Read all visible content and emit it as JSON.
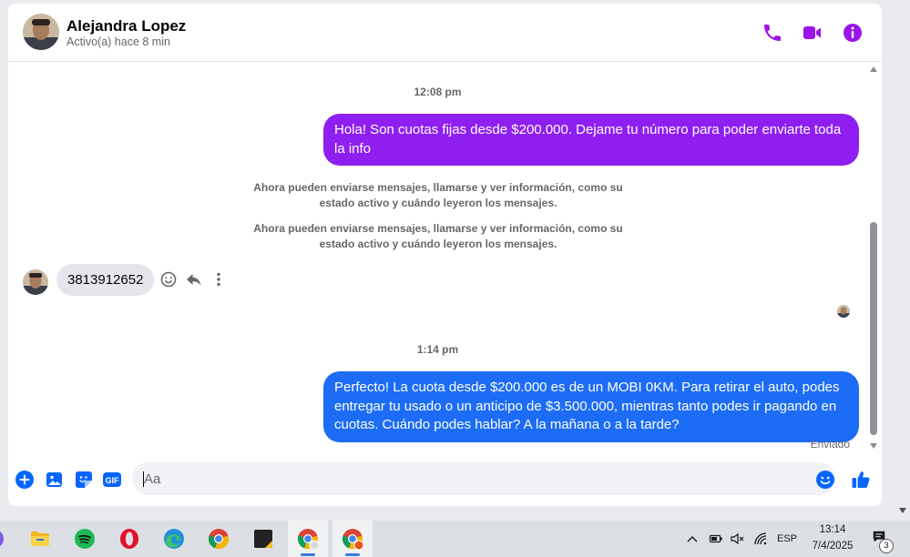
{
  "header": {
    "contact_name": "Alejandra Lopez",
    "status": "Activo(a) hace 8 min",
    "icons": [
      "phone-icon",
      "video-camera-icon",
      "info-icon"
    ]
  },
  "messages": {
    "timestamp_1": "12:08 pm",
    "outgoing_1": "Hola! Son cuotas fijas desde $200.000. Dejame tu número para poder enviarte toda la info",
    "system_note_1": "Ahora pueden enviarse mensajes, llamarse y ver información, como su estado activo y cuándo leyeron los mensajes.",
    "system_note_2": "Ahora pueden enviarse mensajes, llamarse y ver información, como su estado activo y cuándo leyeron los mensajes.",
    "incoming_1": "3813912652",
    "timestamp_2": "1:14 pm",
    "outgoing_2": "Perfecto! La cuota desde $200.000 es de un MOBI 0KM. Para retirar el auto, podes entregar tu usado o un anticipo de $3.500.000, mientras tanto podes ir pagando en cuotas. Cuándo podes hablar? A la mañana o a la tarde?",
    "sent_status": "Enviado"
  },
  "composer": {
    "placeholder": "Aa",
    "gif_label": "GIF"
  },
  "colors": {
    "accent_purple": "#9b13ee",
    "bubble_purple": "#8f1ff0",
    "bubble_blue": "#1c6cf5",
    "composer_blue": "#0866ff"
  },
  "taskbar": {
    "apps": [
      "file-explorer-icon",
      "spotify-icon",
      "opera-icon",
      "edge-icon",
      "chrome-icon",
      "sticky-notes-icon",
      "chrome-profile-icon",
      "chrome-profile-icon"
    ],
    "language": "ESP",
    "time": "13:14",
    "date": "7/4/2025",
    "notification_count": "3"
  }
}
